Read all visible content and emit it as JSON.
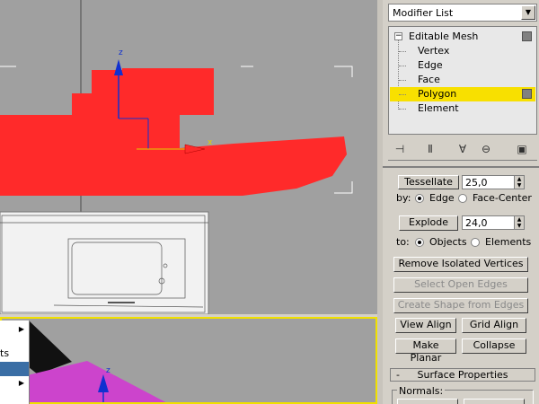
{
  "panel": {
    "modifier_list": "Modifier List",
    "stack": [
      {
        "label": "Editable Mesh",
        "level": 0,
        "expander": "⊟",
        "selected": false,
        "has_swatch": true
      },
      {
        "label": "Vertex",
        "level": 1,
        "selected": false,
        "has_swatch": false
      },
      {
        "label": "Edge",
        "level": 1,
        "selected": false,
        "has_swatch": false
      },
      {
        "label": "Face",
        "level": 1,
        "selected": false,
        "has_swatch": false
      },
      {
        "label": "Polygon",
        "level": 1,
        "selected": true,
        "has_swatch": true
      },
      {
        "label": "Element",
        "level": 1,
        "selected": false,
        "has_swatch": false
      }
    ],
    "toolbar_icons": [
      "pin-stack-icon",
      "show-end-result-icon",
      "make-unique-icon",
      "remove-modifier-icon",
      "configure-sets-icon"
    ],
    "tessellate": {
      "label": "Tessellate",
      "value": "25,0"
    },
    "tess_by": {
      "label": "by:",
      "options": [
        "Edge",
        "Face-Center"
      ],
      "selected": "Edge"
    },
    "explode": {
      "label": "Explode",
      "value": "24,0"
    },
    "explode_to": {
      "label": "to:",
      "options": [
        "Objects",
        "Elements"
      ],
      "selected": "Objects"
    },
    "buttons": {
      "remove_isolated": "Remove Isolated Vertices",
      "select_open_edges": "Select Open Edges",
      "create_shape": "Create Shape from Edges",
      "view_align": "View Align",
      "grid_align": "Grid Align",
      "make_planar": "Make Planar",
      "collapse": "Collapse"
    },
    "surface_properties": {
      "title": "Surface Properties",
      "rollout_sign": "-",
      "normals_label": "Normals:"
    }
  },
  "viewport": {
    "axis_z": "z",
    "axis_x": "x",
    "axis_z_bottom": "z",
    "selection_color": "#ff2a2a",
    "active_border": "#f0e000"
  },
  "menu": {
    "items": [
      {
        "label": "",
        "submenu": true,
        "highlight": false
      },
      {
        "label": "ts",
        "submenu": false,
        "highlight": false
      },
      {
        "label": "",
        "submenu": false,
        "highlight": true
      },
      {
        "label": "",
        "submenu": true,
        "highlight": false
      }
    ]
  }
}
